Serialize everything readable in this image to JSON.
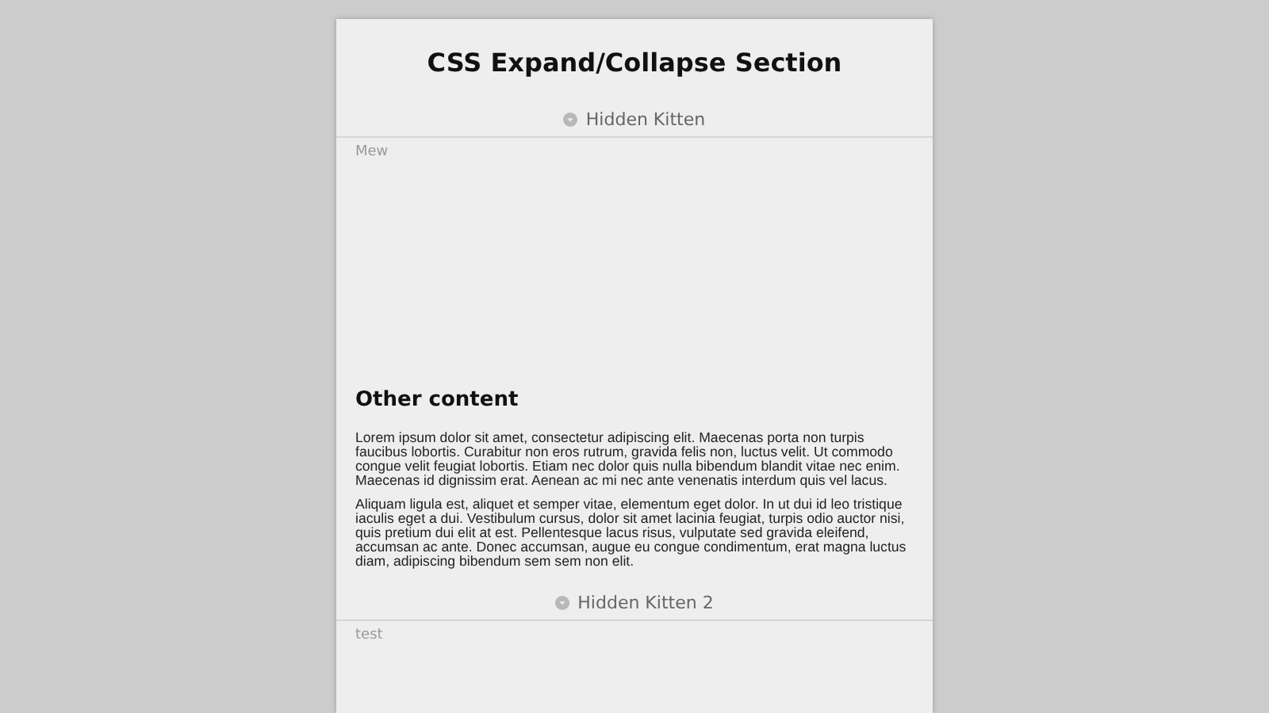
{
  "title": "CSS Expand/Collapse Section",
  "sections": [
    {
      "kind": "toggle",
      "label": "Hidden Kitten",
      "expanded": true,
      "content": "Mew"
    },
    {
      "kind": "text",
      "heading": "Other content",
      "paragraphs": [
        "Lorem ipsum dolor sit amet, consectetur adipiscing elit. Maecenas porta non turpis faucibus lobortis. Curabitur non eros rutrum, gravida felis non, luctus velit. Ut commodo congue velit feugiat lobortis. Etiam nec dolor quis nulla bibendum blandit vitae nec enim. Maecenas id dignissim erat. Aenean ac mi nec ante venenatis interdum quis vel lacus.",
        "Aliquam ligula est, aliquet et semper vitae, elementum eget dolor. In ut dui id leo tristique iaculis eget a dui. Vestibulum cursus, dolor sit amet lacinia feugiat, turpis odio auctor nisi, quis pretium dui elit at est. Pellentesque lacus risus, vulputate sed gravida eleifend, accumsan ac ante. Donec accumsan, augue eu congue condimentum, erat magna luctus diam, adipiscing bibendum sem sem non elit."
      ]
    },
    {
      "kind": "toggle",
      "label": "Hidden Kitten 2",
      "expanded": true,
      "content": "test"
    }
  ]
}
